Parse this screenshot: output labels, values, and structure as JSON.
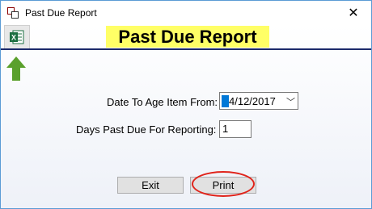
{
  "window": {
    "title": "Past Due Report",
    "close_glyph": "✕"
  },
  "toolbar": {
    "excel_icon": "excel-export-icon"
  },
  "header": {
    "banner": "Past Due Report",
    "banner_color": "#ffff66",
    "rule_color": "#1c2a6b"
  },
  "form": {
    "date_label": "Date To Age Item From:",
    "date_value": "4/12/2017",
    "days_label": "Days Past Due For Reporting:",
    "days_value": "1"
  },
  "buttons": {
    "exit": "Exit",
    "print": "Print"
  },
  "annotations": {
    "arrow_color": "#5aa02c",
    "highlight_color": "#e0241b"
  }
}
